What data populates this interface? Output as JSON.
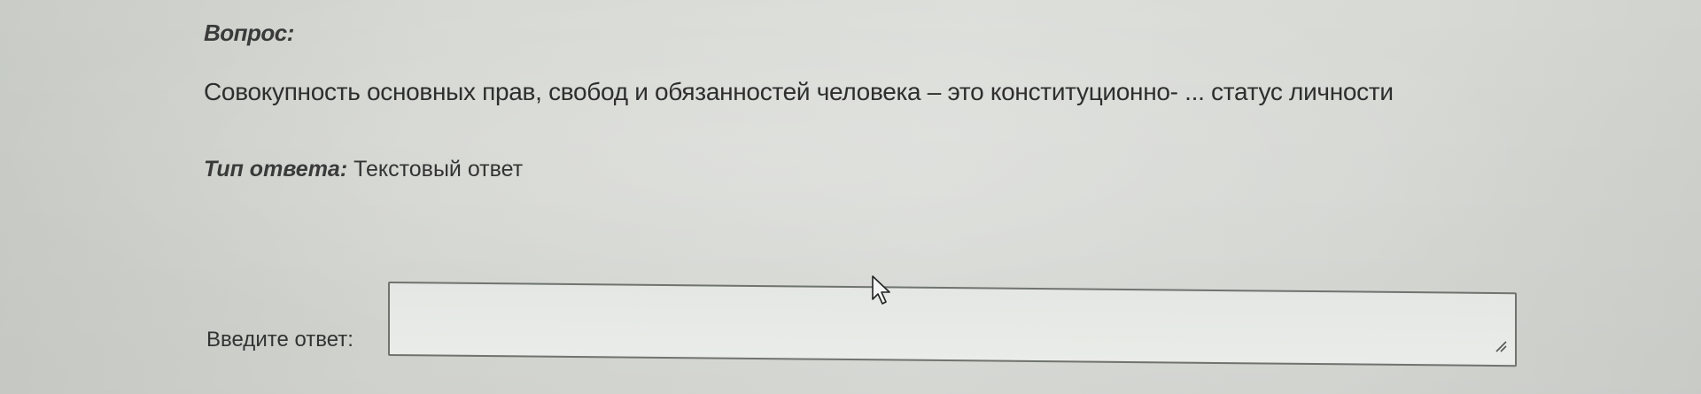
{
  "question": {
    "label": "Вопрос:",
    "text": "Совокупность основных прав, свобод и обязанностей человека – это конституционно- ... статус личности"
  },
  "answer_type": {
    "label": "Тип ответа:",
    "value": " Текстовый ответ"
  },
  "answer": {
    "label": "Введите ответ:",
    "value": "",
    "placeholder": ""
  },
  "icons": {
    "cursor": "mouse-pointer-icon",
    "resize": "resize-grip-icon"
  },
  "colors": {
    "input_border": "#6f746f",
    "input_bg": "#e7eae6",
    "text": "#2e2e2e"
  }
}
